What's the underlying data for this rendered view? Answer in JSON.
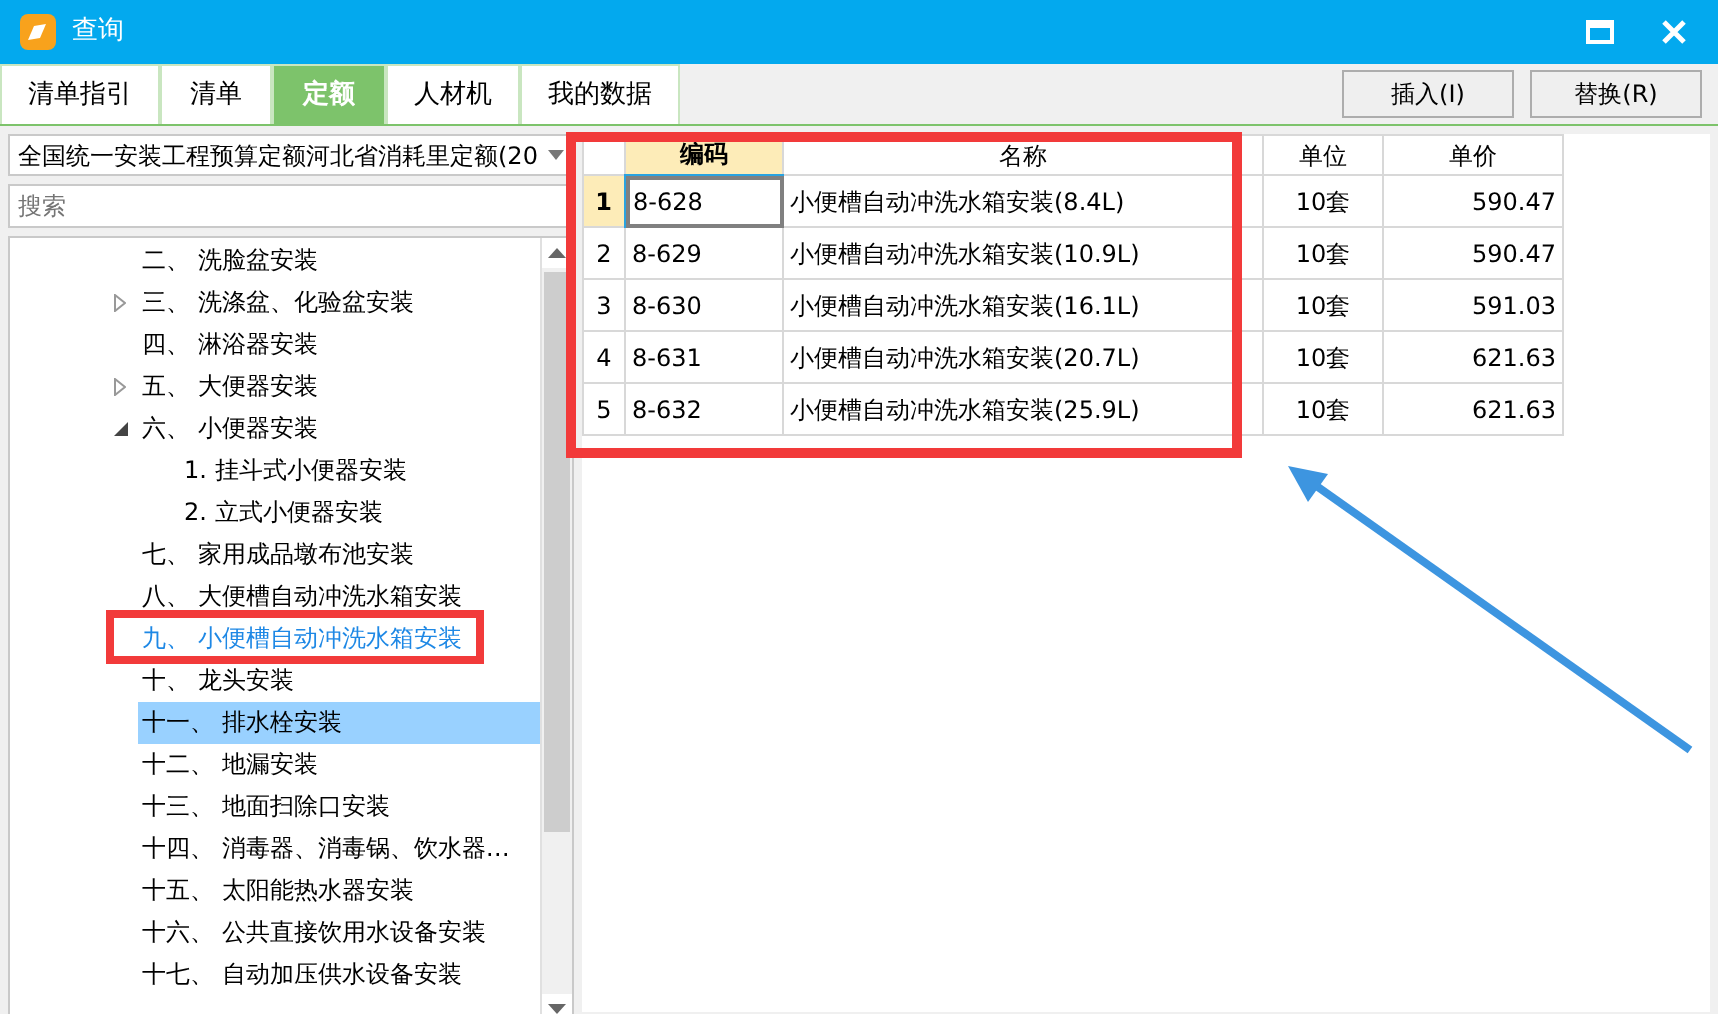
{
  "window": {
    "title": "查询"
  },
  "tabs": [
    {
      "label": "清单指引",
      "selected": false
    },
    {
      "label": "清单",
      "selected": false
    },
    {
      "label": "定额",
      "selected": true
    },
    {
      "label": "人材机",
      "selected": false
    },
    {
      "label": "我的数据",
      "selected": false
    }
  ],
  "buttons": [
    "插入(I)",
    "替换(R)"
  ],
  "library_select": {
    "value": "全国统一安装工程预算定额河北省消耗里定额(20"
  },
  "search": {
    "placeholder": "搜索"
  },
  "tree": {
    "items": [
      {
        "label": "二、 洗脸盆安装",
        "selected": false,
        "hovered": false
      },
      {
        "label": "三、 洗涤盆、化验盆安装",
        "expanded": false,
        "selected": false,
        "hovered": false
      },
      {
        "label": "四、 淋浴器安装",
        "selected": false,
        "hovered": false
      },
      {
        "label": "五、 大便器安装",
        "expanded": false,
        "selected": false,
        "hovered": false
      },
      {
        "label": "六、 小便器安装",
        "expanded": true,
        "selected": false,
        "hovered": false,
        "children": [
          {
            "label": "1. 挂斗式小便器安装",
            "selected": false,
            "hovered": false
          },
          {
            "label": "2. 立式小便器安装",
            "selected": false,
            "hovered": false
          }
        ]
      },
      {
        "label": "七、 家用成品墩布池安装",
        "selected": false,
        "hovered": false
      },
      {
        "label": "八、 大便槽自动冲洗水箱安装",
        "selected": false,
        "hovered": false
      },
      {
        "label": "九、 小便槽自动冲洗水箱安装",
        "selected": false,
        "hovered": true
      },
      {
        "label": "十、 龙头安装",
        "selected": false,
        "hovered": false
      },
      {
        "label": "十一、 排水栓安装",
        "selected": true,
        "hovered": false
      },
      {
        "label": "十二、 地漏安装",
        "selected": false,
        "hovered": false
      },
      {
        "label": "十三、 地面扫除口安装",
        "selected": false,
        "hovered": false
      },
      {
        "label": "十四、 消毒器、消毒锅、饮水器…",
        "selected": false,
        "hovered": false
      },
      {
        "label": "十五、 太阳能热水器安装",
        "selected": false,
        "hovered": false
      },
      {
        "label": "十六、 公共直接饮用水设备安装",
        "selected": false,
        "hovered": false
      },
      {
        "label": "十七、 自动加压供水设备安装",
        "selected": false,
        "hovered": false
      }
    ]
  },
  "table": {
    "columns": [
      "编码",
      "名称",
      "单位",
      "单价"
    ],
    "rows": [
      {
        "number": "1",
        "selected": true,
        "cells": [
          "8-628",
          "小便槽自动冲洗水箱安装(8.4L)",
          "10套",
          "590.47"
        ]
      },
      {
        "number": "2",
        "selected": false,
        "cells": [
          "8-629",
          "小便槽自动冲洗水箱安装(10.9L)",
          "10套",
          "590.47"
        ]
      },
      {
        "number": "3",
        "selected": false,
        "cells": [
          "8-630",
          "小便槽自动冲洗水箱安装(16.1L)",
          "10套",
          "591.03"
        ]
      },
      {
        "number": "4",
        "selected": false,
        "cells": [
          "8-631",
          "小便槽自动冲洗水箱安装(20.7L)",
          "10套",
          "621.63"
        ]
      },
      {
        "number": "5",
        "selected": false,
        "cells": [
          "8-632",
          "小便槽自动冲洗水箱安装(25.9L)",
          "10套",
          "621.63"
        ]
      }
    ]
  }
}
